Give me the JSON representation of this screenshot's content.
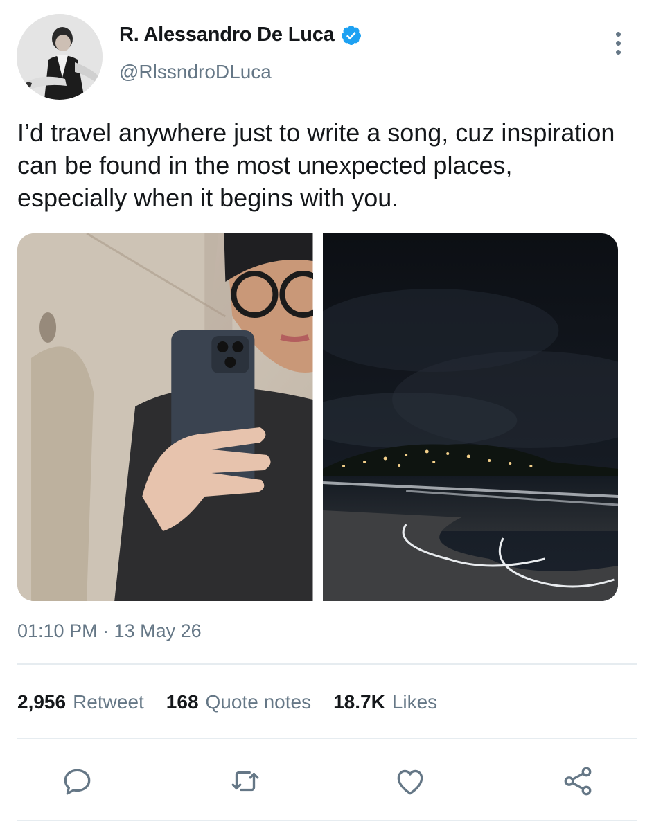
{
  "author": {
    "display_name": "R. Alessandro De Luca",
    "handle": "@RlssndroDLuca",
    "verified": true
  },
  "tweet": {
    "text": "I’d travel anywhere just to write a song, cuz inspiration can be found in the most unexpected places, especially when it begins with you.",
    "timestamp": "01:10 PM · 13 May 26"
  },
  "stats": {
    "retweets_count": "2,956",
    "retweets_label": "Retweet",
    "quotes_count": "168",
    "quotes_label": "Quote notes",
    "likes_count": "18.7K",
    "likes_label": "Likes"
  },
  "icons": {
    "verified": "verified-badge-icon",
    "more": "more-vertical-icon",
    "reply": "reply-icon",
    "retweet": "retweet-icon",
    "like": "heart-icon",
    "share": "share-icon"
  },
  "colors": {
    "accent": "#1da1f2",
    "secondary_text": "#657786",
    "primary_text": "#14171a",
    "divider": "#e6ecf0"
  }
}
